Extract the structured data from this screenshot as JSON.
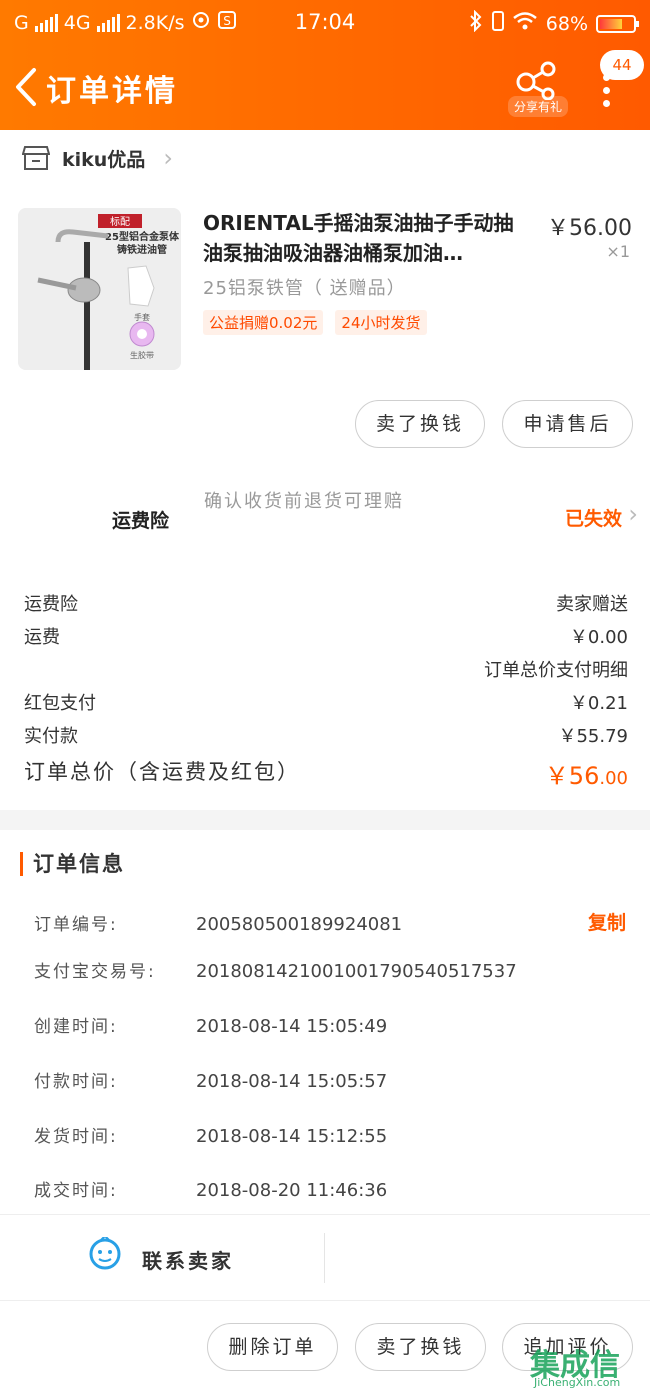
{
  "status_bar": {
    "carrier_1": "G",
    "carrier_2": "4G",
    "speed": "2.8K/s",
    "time": "17:04",
    "battery": "68%"
  },
  "header": {
    "title": "订单详情",
    "share_label": "分享有礼",
    "badge": "44"
  },
  "shop": {
    "name": "kiku优品"
  },
  "product": {
    "title": "ORIENTAL手摇油泵油抽子手动抽油泵抽油吸油器油桶泵加油…",
    "price": "￥56.00",
    "qty": "×1",
    "sku": "25铝泵铁管（ 送赠品）",
    "tags": [
      "公益捐赠0.02元",
      "24小时发货"
    ],
    "image_labels": {
      "corner": "标配",
      "line1": "25型铝合金泵体",
      "line2": "铸铁进油管",
      "glove": "手套",
      "tape": "生胶带"
    }
  },
  "actions": {
    "exchange": "卖了换钱",
    "after_sale": "申请售后"
  },
  "insurance": {
    "label": "运费险",
    "desc": "确认收货前退货可理赔",
    "status": "已失效"
  },
  "fees": {
    "insurance_label": "运费险",
    "insurance_value": "卖家赠送",
    "shipping_label": "运费",
    "shipping_value": "￥0.00",
    "detail_link": "订单总价支付明细",
    "redpacket_label": "红包支付",
    "redpacket_value": "￥0.21",
    "paid_label": "实付款",
    "paid_value": "￥55.79",
    "total_label": "订单总价（含运费及红包）",
    "total_main": "￥56",
    "total_cents": ".00"
  },
  "order_info": {
    "title": "订单信息",
    "copy": "复制",
    "rows": [
      {
        "k": "订单编号:",
        "v": "200580500189924081"
      },
      {
        "k": "支付宝交易号:",
        "v": "2018081421001001790540517537"
      },
      {
        "k": "创建时间:",
        "v": "2018-08-14 15:05:49"
      },
      {
        "k": "付款时间:",
        "v": "2018-08-14 15:05:57"
      },
      {
        "k": "发货时间:",
        "v": "2018-08-14 15:12:55"
      },
      {
        "k": "成交时间:",
        "v": "2018-08-20 11:46:36"
      }
    ]
  },
  "contact": {
    "label": "联系卖家"
  },
  "bottom_actions": {
    "delete": "删除订单",
    "exchange": "卖了换钱",
    "review": "追加评价"
  },
  "watermark": {
    "text": "集成信",
    "sub": "JiChengXin.com"
  },
  "colors": {
    "accent": "#ff5a00",
    "header_start": "#ff7a00"
  }
}
